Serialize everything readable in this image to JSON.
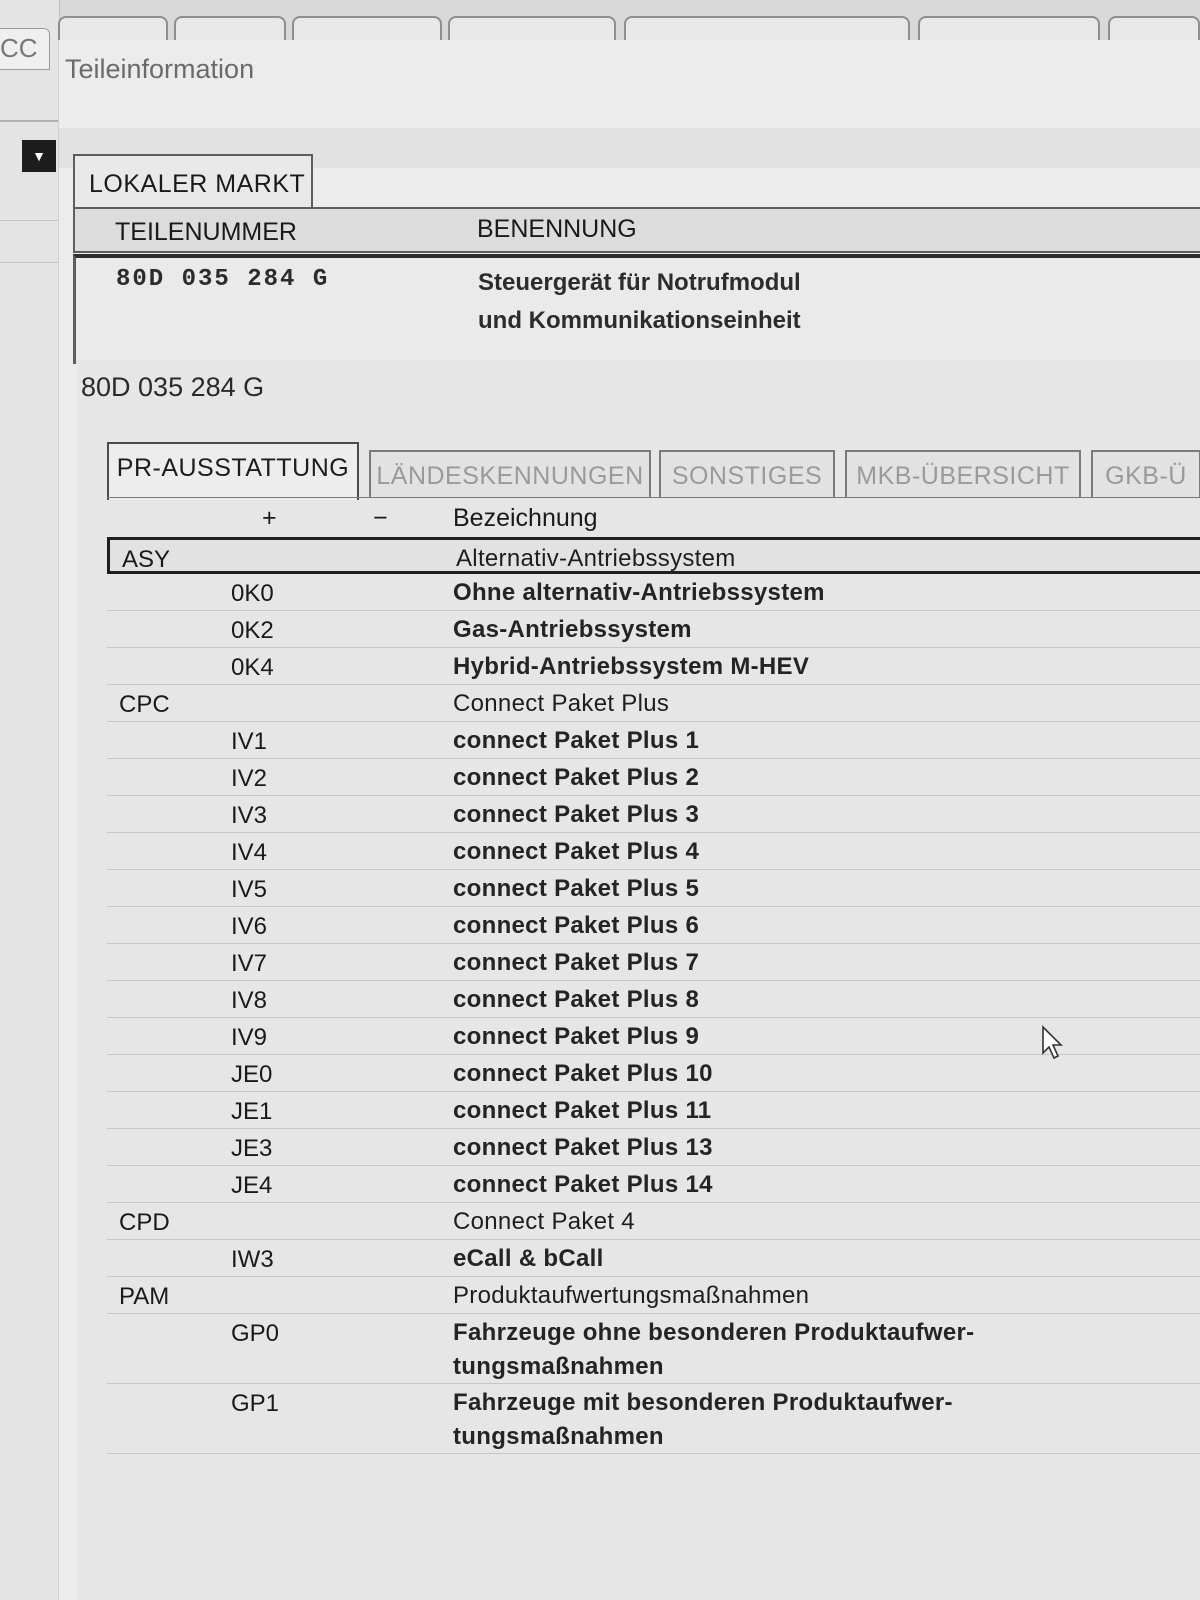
{
  "app": {
    "left_tab_label": "CC",
    "dropdown_icon": "triangle-down"
  },
  "dialog": {
    "title": "Teileinformation",
    "market_tab": "LOKALER MARKT",
    "columns": {
      "part_number": "TEILENUMMER",
      "name": "BENENNUNG"
    },
    "part": {
      "number": "80D 035 284 G",
      "name_line1": "Steuergerät für Notrufmodul",
      "name_line2": "und Kommunikationseinheit"
    }
  },
  "detail": {
    "title": "80D 035 284 G",
    "tabs": [
      "PR-AUSSTATTUNG",
      "LÄNDESKENNUNGEN",
      "SONSTIGES",
      "MKB-ÜBERSICHT",
      "GKB-Ü"
    ],
    "active_tab": 0,
    "table": {
      "headers": {
        "plus": "+",
        "minus": "−",
        "name": "Bezeichnung"
      },
      "rows": [
        {
          "kind": "group",
          "code": "ASY",
          "name": "Alternativ-Antriebssystem",
          "selected": true
        },
        {
          "kind": "opt",
          "code": "0K0",
          "name": "Ohne alternativ-Antriebssystem"
        },
        {
          "kind": "opt",
          "code": "0K2",
          "name": "Gas-Antriebssystem"
        },
        {
          "kind": "opt",
          "code": "0K4",
          "name": "Hybrid-Antriebssystem M-HEV"
        },
        {
          "kind": "group",
          "code": "CPC",
          "name": "Connect Paket Plus"
        },
        {
          "kind": "opt",
          "code": "IV1",
          "name": "connect Paket Plus 1"
        },
        {
          "kind": "opt",
          "code": "IV2",
          "name": "connect Paket Plus 2"
        },
        {
          "kind": "opt",
          "code": "IV3",
          "name": "connect Paket Plus 3"
        },
        {
          "kind": "opt",
          "code": "IV4",
          "name": "connect Paket Plus 4"
        },
        {
          "kind": "opt",
          "code": "IV5",
          "name": "connect Paket Plus 5"
        },
        {
          "kind": "opt",
          "code": "IV6",
          "name": "connect Paket Plus 6"
        },
        {
          "kind": "opt",
          "code": "IV7",
          "name": "connect Paket Plus 7"
        },
        {
          "kind": "opt",
          "code": "IV8",
          "name": "connect Paket Plus 8"
        },
        {
          "kind": "opt",
          "code": "IV9",
          "name": "connect Paket Plus 9"
        },
        {
          "kind": "opt",
          "code": "JE0",
          "name": "connect Paket Plus 10"
        },
        {
          "kind": "opt",
          "code": "JE1",
          "name": "connect Paket Plus 11"
        },
        {
          "kind": "opt",
          "code": "JE3",
          "name": "connect Paket Plus 13"
        },
        {
          "kind": "opt",
          "code": "JE4",
          "name": "connect Paket Plus 14"
        },
        {
          "kind": "group",
          "code": "CPD",
          "name": "Connect Paket 4"
        },
        {
          "kind": "opt",
          "code": "IW3",
          "name": "eCall & bCall"
        },
        {
          "kind": "group",
          "code": "PAM",
          "name": "Produktaufwertungsmaßnahmen"
        },
        {
          "kind": "opt",
          "code": "GP0",
          "name": "Fahrzeuge ohne besonderen Produktaufwer-",
          "name2": "tungsmaßnahmen"
        },
        {
          "kind": "opt",
          "code": "GP1",
          "name": "Fahrzeuge mit besonderen Produktaufwer-",
          "name2": "tungsmaßnahmen"
        }
      ]
    }
  }
}
